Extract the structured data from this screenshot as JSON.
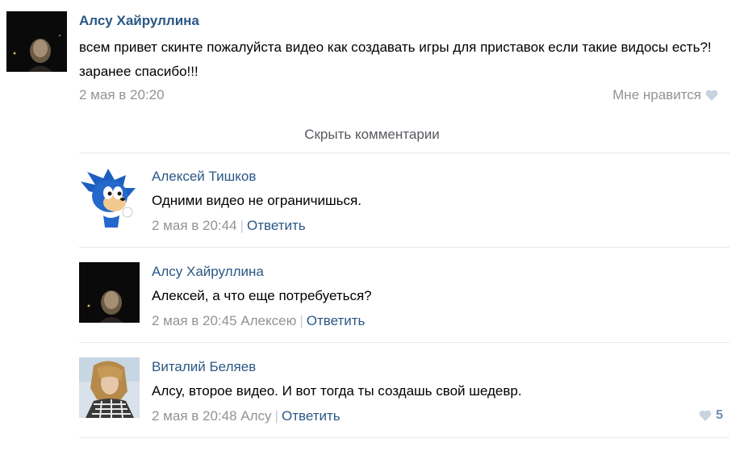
{
  "post": {
    "author": "Алсу Хайруллина",
    "text": "всем привет скинте пожалуйста видео как создавать игры для приставок если такие видосы есть?!заранее спасибо!!!",
    "date": "2 мая в 20:20",
    "like_label": "Мне нравится"
  },
  "hide_comments_label": "Скрыть комментарии",
  "comments": [
    {
      "author": "Алексей Тишков",
      "text": "Одними видео не ограничишься.",
      "date": "2 мая в 20:44",
      "reply_label": "Ответить"
    },
    {
      "author": "Алсу Хайруллина",
      "text": "Алексей, а что еще потребуеться?",
      "date": "2 мая в 20:45",
      "reply_to": "Алексею",
      "reply_label": "Ответить"
    },
    {
      "author": "Виталий Беляев",
      "text": "Алсу, второе видео. И вот тогда ты создашь свой шедевр.",
      "date": "2 мая в 20:48",
      "reply_to": "Алсу",
      "reply_label": "Ответить",
      "likes": "5"
    }
  ],
  "colors": {
    "link": "#2a5885",
    "meta": "#939393",
    "divider": "#e7e8ec",
    "like_heart": "#c7d3df"
  }
}
